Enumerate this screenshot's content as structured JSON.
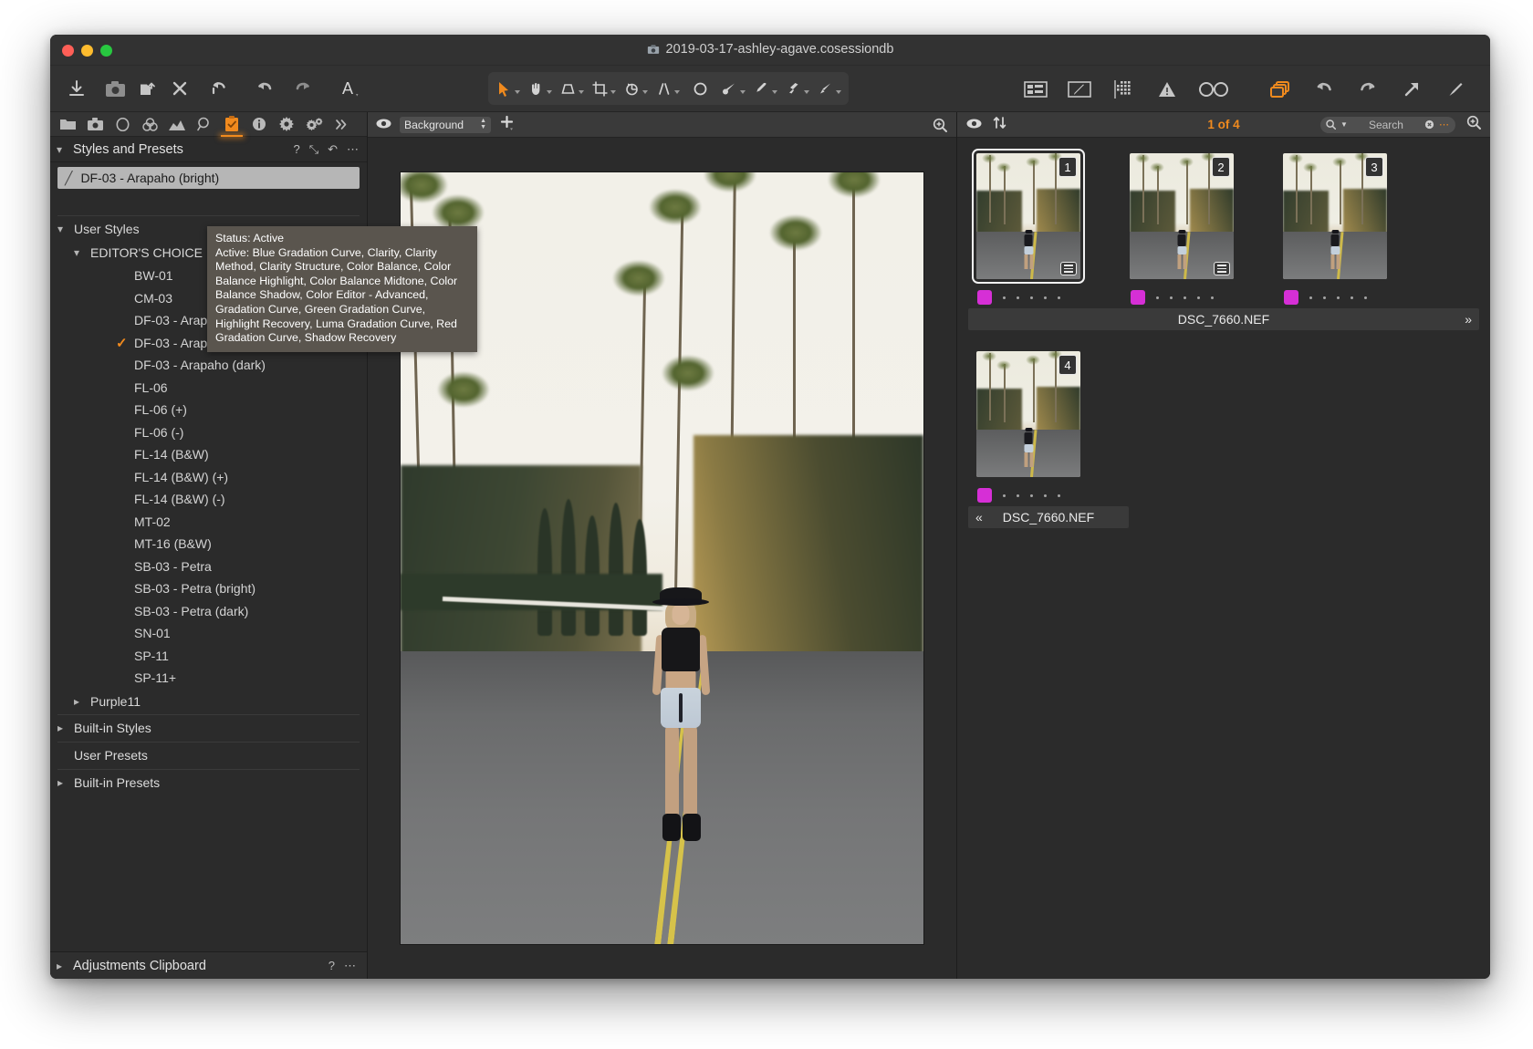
{
  "window": {
    "title": "2019-03-17-ashley-agave.cosessiondb",
    "title_icon": "capture-one-session-icon"
  },
  "main_toolbar": {
    "left_buttons": [
      {
        "name": "import-images",
        "icon": "download-arrow-icon"
      },
      {
        "name": "capture",
        "icon": "camera-icon"
      },
      {
        "name": "export-images",
        "icon": "folder-export-icon"
      },
      {
        "name": "delete",
        "icon": "x-icon"
      },
      {
        "name": "reset-adjustments",
        "icon": "reset-arrow-icon"
      },
      {
        "name": "undo",
        "icon": "undo-arrow-icon"
      },
      {
        "name": "redo",
        "icon": "redo-arrow-icon"
      },
      {
        "name": "text-tool",
        "icon": "letter-a-icon"
      }
    ],
    "tools": [
      {
        "name": "pointer-tool",
        "icon": "cursor-arrow-icon",
        "active": true
      },
      {
        "name": "pan-tool",
        "icon": "hand-icon",
        "active": false
      },
      {
        "name": "keystone-tool",
        "icon": "keystone-icon",
        "active": false
      },
      {
        "name": "crop-tool",
        "icon": "crop-icon",
        "active": false
      },
      {
        "name": "rotate-tool",
        "icon": "rotate-icon",
        "active": false
      },
      {
        "name": "straighten-tool",
        "icon": "straighten-icon",
        "active": false
      },
      {
        "name": "spot-removal-tool",
        "icon": "circle-icon",
        "active": false
      },
      {
        "name": "draw-mask-tool",
        "icon": "brush-icon",
        "active": false
      },
      {
        "name": "color-picker-tool",
        "icon": "eyedropper-icon",
        "active": false
      },
      {
        "name": "erase-mask-tool",
        "icon": "eraser-icon",
        "active": false
      },
      {
        "name": "heal-tool",
        "icon": "heal-brush-icon",
        "active": false
      }
    ],
    "right_buttons": [
      {
        "name": "viewer-toggle",
        "icon": "viewer-layout-icon",
        "accent": false
      },
      {
        "name": "annotations-toggle",
        "icon": "pen-tablet-icon",
        "accent": false
      },
      {
        "name": "focus-mask",
        "icon": "grid-mask-icon",
        "accent": false
      },
      {
        "name": "exposure-warning",
        "icon": "warning-triangle-icon",
        "accent": false
      },
      {
        "name": "proof-profile",
        "icon": "glasses-icon",
        "accent": false
      },
      {
        "name": "variants",
        "icon": "stack-copies-icon",
        "accent": true
      },
      {
        "name": "rotate-left",
        "icon": "rotate-ccw-icon",
        "accent": false
      },
      {
        "name": "rotate-right",
        "icon": "rotate-cw-icon",
        "accent": false
      },
      {
        "name": "open-in-external",
        "icon": "arrow-up-right-icon",
        "accent": false
      },
      {
        "name": "pen-tool",
        "icon": "pen-nib-icon",
        "accent": false
      }
    ]
  },
  "left_panel": {
    "tool_tabs": [
      {
        "name": "library-tab",
        "icon": "folder-icon",
        "selected": false
      },
      {
        "name": "capture-tab",
        "icon": "camera-icon",
        "selected": false
      },
      {
        "name": "lens-tab",
        "icon": "lens-circle-icon",
        "selected": false
      },
      {
        "name": "color-tab",
        "icon": "color-circles-icon",
        "selected": false
      },
      {
        "name": "exposure-tab",
        "icon": "histogram-icon",
        "selected": false
      },
      {
        "name": "details-tab",
        "icon": "magnifier-icon",
        "selected": false
      },
      {
        "name": "adjustments-tab",
        "icon": "orange-clipboard-icon",
        "selected": true
      },
      {
        "name": "metadata-tab",
        "icon": "info-icon",
        "selected": false
      },
      {
        "name": "output-tab",
        "icon": "gear-icon",
        "selected": false
      },
      {
        "name": "batch-tab",
        "icon": "gears-icon",
        "selected": false
      },
      {
        "name": "more-tabs",
        "icon": "chevron-double-right-icon",
        "selected": false
      }
    ],
    "panel_title": "Styles and Presets",
    "panel_actions": [
      {
        "name": "help-button",
        "glyph": "?"
      },
      {
        "name": "expand-button",
        "glyph": "⤡"
      },
      {
        "name": "reset-button",
        "glyph": "↶"
      },
      {
        "name": "menu-button",
        "glyph": "⋯"
      }
    ],
    "selected_style": "DF-03 - Arapaho (bright)",
    "tooltip": {
      "status_line": "Status: Active",
      "body": "Active: Blue Gradation Curve, Clarity, Clarity Method, Clarity Structure, Color Balance, Color Balance Highlight, Color Balance Midtone, Color Balance Shadow, Color Editor - Advanced, Gradation Curve, Green Gradation Curve, Highlight Recovery, Luma Gradation Curve, Red Gradation Curve, Shadow Recovery"
    },
    "tree": {
      "user_styles_label": "User Styles",
      "editors_choice_label": "EDITOR'S CHOICE",
      "styles": [
        {
          "label": "BW-01",
          "checked": false
        },
        {
          "label": "CM-03",
          "checked": false
        },
        {
          "label": "DF-03 - Arapaho",
          "checked": false
        },
        {
          "label": "DF-03 - Arapaho (bright)",
          "checked": true
        },
        {
          "label": "DF-03 - Arapaho (dark)",
          "checked": false
        },
        {
          "label": "FL-06",
          "checked": false
        },
        {
          "label": "FL-06 (+)",
          "checked": false
        },
        {
          "label": "FL-06 (-)",
          "checked": false
        },
        {
          "label": "FL-14 (B&W)",
          "checked": false
        },
        {
          "label": "FL-14 (B&W) (+)",
          "checked": false
        },
        {
          "label": "FL-14 (B&W) (-)",
          "checked": false
        },
        {
          "label": "MT-02",
          "checked": false
        },
        {
          "label": "MT-16 (B&W)",
          "checked": false
        },
        {
          "label": "SB-03 - Petra",
          "checked": false
        },
        {
          "label": "SB-03 - Petra (bright)",
          "checked": false
        },
        {
          "label": "SB-03 - Petra (dark)",
          "checked": false
        },
        {
          "label": "SN-01",
          "checked": false
        },
        {
          "label": "SP-11",
          "checked": false
        },
        {
          "label": "SP-11+",
          "checked": false
        }
      ],
      "purple_group_label": "Purple11",
      "builtin_styles_label": "Built-in Styles",
      "user_presets_label": "User Presets",
      "builtin_presets_label": "Built-in Presets"
    },
    "clipboard": {
      "label": "Adjustments Clipboard",
      "help_glyph": "?",
      "menu_glyph": "⋯"
    }
  },
  "viewer": {
    "layer_value": "Background",
    "eye_icon": "eye-icon",
    "add_layer_icon": "plus-icon",
    "zoom_icon": "magnifier-plus-icon"
  },
  "browser": {
    "eye_icon": "eye-icon",
    "sort_icon": "sort-updown-icon",
    "counter": "1 of 4",
    "search": {
      "placeholder": "Search",
      "value": "",
      "search_icon": "magnifier-icon",
      "clear_icon": "clear-x-icon",
      "options_icon": "ellipsis-icon"
    },
    "zoom_icon": "magnifier-plus-icon",
    "thumbnails": [
      {
        "number": "1",
        "selected": true,
        "color_tag": "#d62fd6",
        "rating_dots": 5,
        "has_meta_badge": true
      },
      {
        "number": "2",
        "selected": false,
        "color_tag": "#d62fd6",
        "rating_dots": 5,
        "has_meta_badge": true
      },
      {
        "number": "3",
        "selected": false,
        "color_tag": "#d62fd6",
        "rating_dots": 5,
        "has_meta_badge": false
      },
      {
        "number": "4",
        "selected": false,
        "color_tag": "#d62fd6",
        "rating_dots": 5,
        "has_meta_badge": false
      }
    ],
    "filename_row1": "DSC_7660.NEF",
    "filename_row2": "DSC_7660.NEF",
    "row1_arrow": "»",
    "row2_arrow": "«"
  },
  "colors": {
    "accent_orange": "#f08a1e",
    "color_tag_magenta": "#d62fd6",
    "panel_bg": "#2b2b2b",
    "toolbar_bg": "#323232",
    "tooltip_bg": "#5a554e",
    "selected_row_bg": "#b6b6b6"
  }
}
